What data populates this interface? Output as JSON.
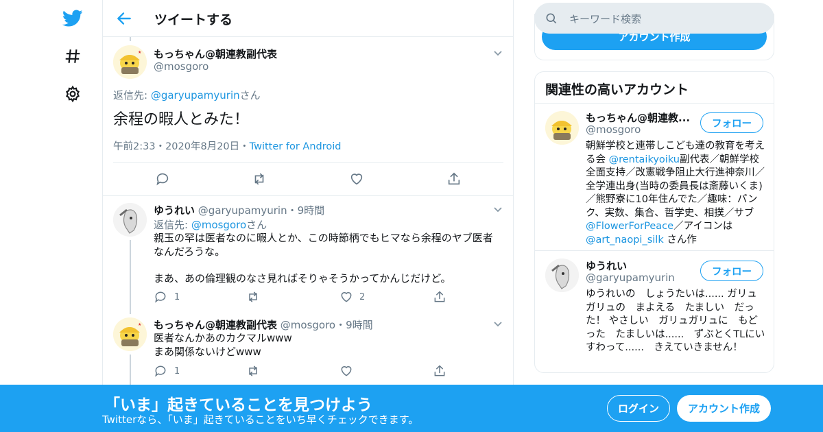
{
  "colors": {
    "brand": "#1da1f2",
    "link": "#1b95e0",
    "muted": "#657786",
    "border": "#e6ecf0"
  },
  "nav": {
    "icons": [
      "twitter-logo-icon",
      "hashtag-icon",
      "gear-icon"
    ]
  },
  "header": {
    "title": "ツイートする"
  },
  "focus_tweet": {
    "name": "もっちゃん@朝連教副代表",
    "handle": "@mosgoro",
    "reply_to_prefix": "返信先: ",
    "reply_to_user": "@garyupamyurin",
    "reply_to_suffix": "さん",
    "text": "余程の暇人とみた！",
    "time": "午前2:33",
    "date": "2020年8月20日",
    "dot": "・",
    "source": "Twitter for Android"
  },
  "replies": [
    {
      "name": "ゆうれい",
      "handle": "@garyupamyurin",
      "dot": "・",
      "time": "9時間",
      "reply_to_prefix": "返信先: ",
      "reply_to_user": "@mosgoro",
      "reply_to_suffix": "さん",
      "lines": [
        "親玉の罕は医者なのに暇人とか、この時節柄でもヒマなら余程のヤブ医者",
        "なんだろうな。",
        "",
        "まあ、あの倫理観のなさ見ればそりゃそうかってかんじだけど。"
      ],
      "reply_count": "1",
      "like_count": "2"
    },
    {
      "name": "もっちゃん@朝連教副代表",
      "handle": "@mosgoro",
      "dot": "・",
      "time": "9時間",
      "lines": [
        "医者なんかあのカクマルwww",
        "まあ関係ないけどwww"
      ],
      "reply_count": "1"
    }
  ],
  "search": {
    "placeholder": "キーワード検索"
  },
  "signup_partial": {
    "label": "アカウント作成"
  },
  "related": {
    "title": "関連性の高いアカウント",
    "follow_label": "フォロー",
    "accounts": [
      {
        "name": "もっちゃん@朝連教...",
        "handle": "@mosgoro",
        "bio": [
          {
            "t": "朝鮮学校と連帯しこども達の教育を考"
          },
          {
            "t": "える会 "
          },
          {
            "l": "@rentaikyoiku"
          },
          {
            "t": "副代表／朝鮮学"
          },
          {
            "t": "校全面支持／改憲戦争阻止大行進神奈"
          },
          {
            "t": "川／全学連出身(当時の委員長は斎藤"
          },
          {
            "t": "いくま)／熊野寮に10年住んでた／趣"
          },
          {
            "t": "味：パンク、実数、集合、哲学史、相"
          },
          {
            "t": "撲／サブ"
          },
          {
            "l": "@FlowerForPeace"
          },
          {
            "t": "／アイコン"
          },
          {
            "t": "は "
          },
          {
            "l": "@art_naopi_silk"
          },
          {
            "t": " さん作"
          }
        ]
      },
      {
        "name": "ゆうれい",
        "handle": "@garyupamyurin",
        "bio": [
          {
            "t": "ゆうれいの　しょうたいは...... ガリュ"
          },
          {
            "t": "ガリュの　まよえる　たましい　だっ"
          },
          {
            "t": "た！ やさしい　ガリュガリュに　も"
          },
          {
            "t": "どった　たましいは......　ずぶとく"
          },
          {
            "t": "TLにいすわって......　きえていきませ"
          },
          {
            "t": "ん！"
          }
        ]
      }
    ]
  },
  "banner": {
    "title": "「いま」起きていることを見つけよう",
    "subtitle": "Twitterなら、「いま」起きていることをいち早くチェックできます。",
    "login_label": "ログイン",
    "signup_label": "アカウント作成"
  }
}
